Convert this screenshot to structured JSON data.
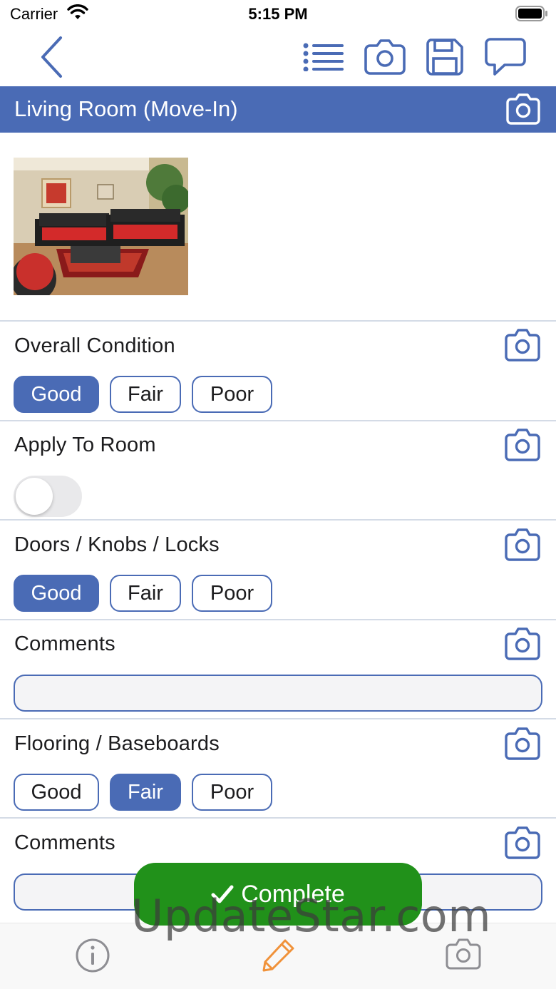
{
  "status_bar": {
    "carrier": "Carrier",
    "time": "5:15 PM"
  },
  "nav": {
    "back_icon": "chevron-left-icon",
    "actions": [
      "list-icon",
      "camera-icon",
      "save-icon",
      "comment-icon"
    ]
  },
  "room": {
    "title": "Living Room (Move-In)"
  },
  "rows": {
    "overall_condition": {
      "label": "Overall Condition",
      "options": [
        "Good",
        "Fair",
        "Poor"
      ],
      "selected": "Good"
    },
    "apply_to_room": {
      "label": "Apply To Room",
      "toggle_on": false
    },
    "doors": {
      "label": "Doors / Knobs / Locks",
      "options": [
        "Good",
        "Fair",
        "Poor"
      ],
      "selected": "Good"
    },
    "doors_comments": {
      "label": "Comments",
      "value": ""
    },
    "flooring": {
      "label": "Flooring / Baseboards",
      "options": [
        "Good",
        "Fair",
        "Poor"
      ],
      "selected": "Fair"
    },
    "flooring_comments": {
      "label": "Comments",
      "value": ""
    }
  },
  "complete_button": {
    "label": "Complete"
  },
  "watermark": "UpdateStar.com",
  "tab_bar": {
    "items": [
      "info-icon",
      "pencil-icon",
      "camera-icon"
    ],
    "active": "pencil-icon"
  },
  "colors": {
    "accent": "#4a6bb5",
    "complete": "#21911a",
    "active_tab": "#f0923a",
    "inactive_tab": "#8e8e93"
  }
}
